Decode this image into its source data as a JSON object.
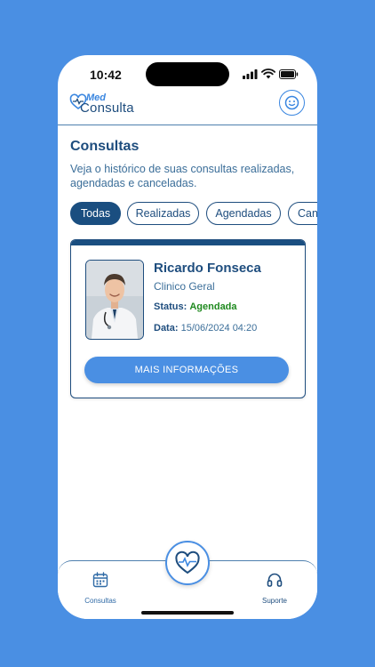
{
  "status_bar": {
    "time": "10:42"
  },
  "app": {
    "logo_top": "Med",
    "logo_bottom": "Consulta"
  },
  "page": {
    "title": "Consultas",
    "description": "Veja o histórico de suas consultas realizadas, agendadas e canceladas."
  },
  "filters": [
    {
      "label": "Todas",
      "active": true
    },
    {
      "label": "Realizadas",
      "active": false
    },
    {
      "label": "Agendadas",
      "active": false
    },
    {
      "label": "Canceladas",
      "active": false
    }
  ],
  "appointment": {
    "doctor_name": "Ricardo Fonseca",
    "specialty": "Clinico Geral",
    "status_label": "Status:",
    "status_value": "Agendada",
    "date_label": "Data:",
    "date_value": "15/06/2024 04:20",
    "button_label": "MAIS INFORMAÇÕES"
  },
  "bottom_nav": {
    "consultas_label": "Consultas",
    "suporte_label": "Suporte"
  },
  "icons": {
    "avatar": "smiley-face-icon",
    "consultas": "calendar-icon",
    "suporte": "headphones-icon",
    "center": "heart-stethoscope-icon"
  },
  "colors": {
    "background": "#4a8fe3",
    "primary_dark": "#1a4e80",
    "accent": "#4a8fe3",
    "status_scheduled": "#1f8a1f"
  }
}
